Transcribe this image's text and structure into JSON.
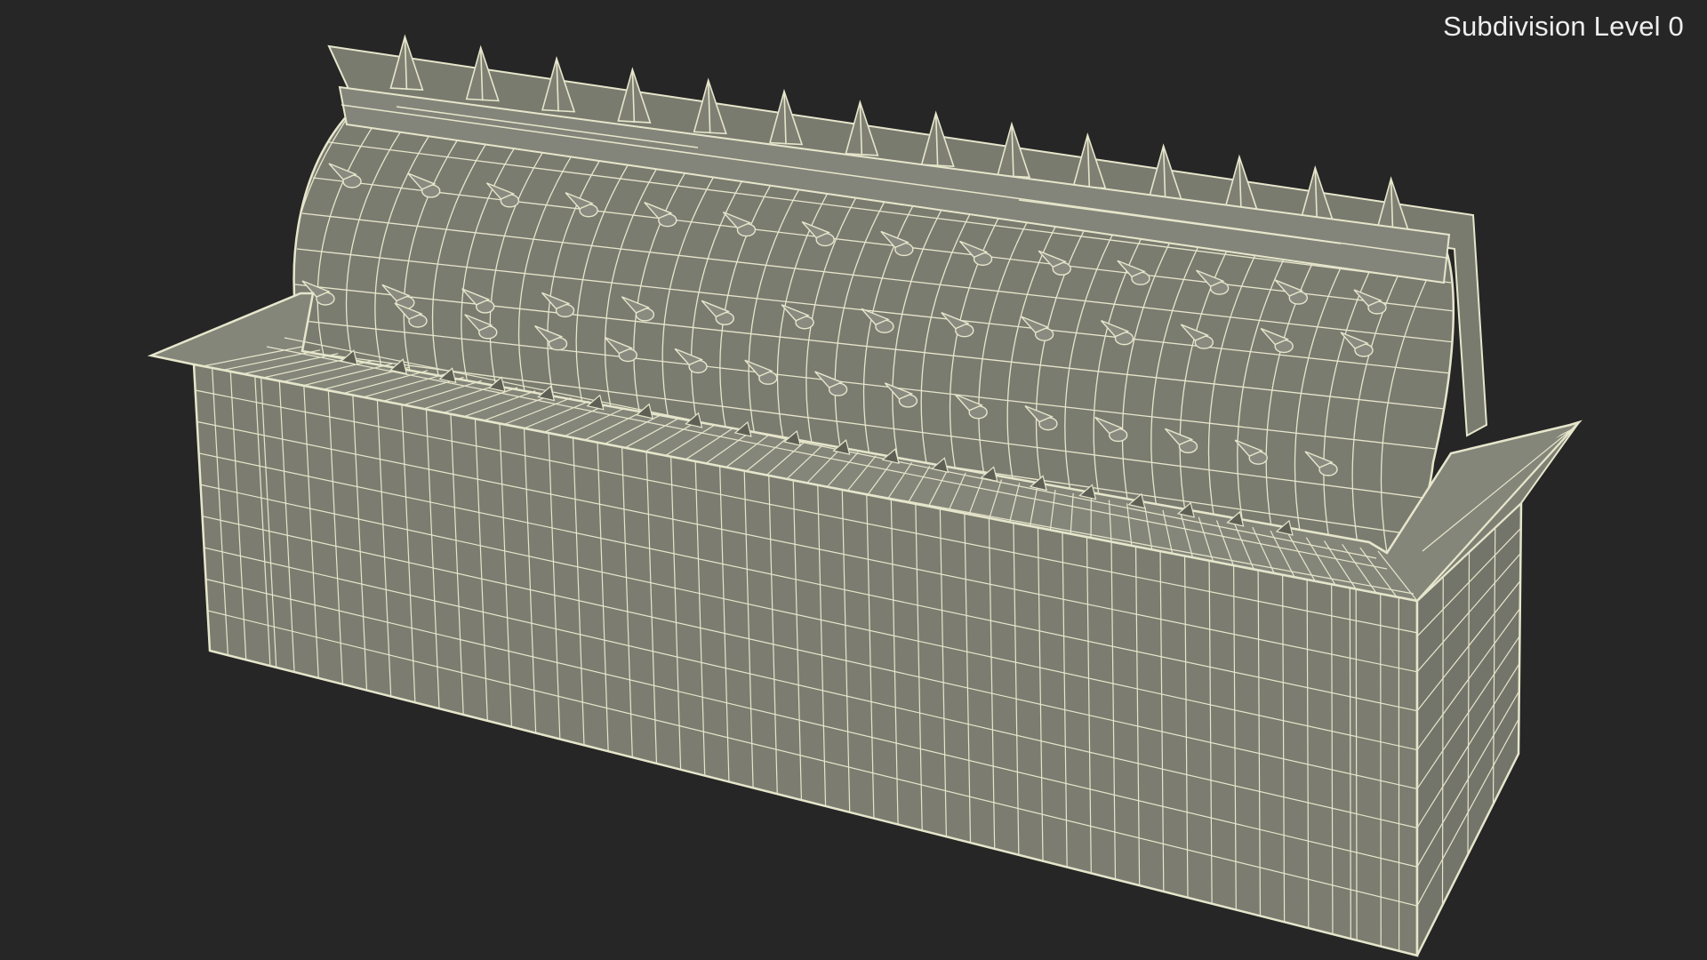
{
  "overlay": {
    "subdivision_label": "Subdivision Level 0"
  },
  "colors": {
    "background": "#262626",
    "surface": "#7c7d70",
    "surface_dark": "#6a6b60",
    "surface_light": "#8a8b7e",
    "wire": "#e6e6cc",
    "overlay_text": "#eeeeee"
  },
  "model": {
    "object": "spiked-roller-barrier-wireframe",
    "top_spike_count": 14,
    "drum_spike_rows": 3,
    "drum_spikes_per_row": 14
  }
}
